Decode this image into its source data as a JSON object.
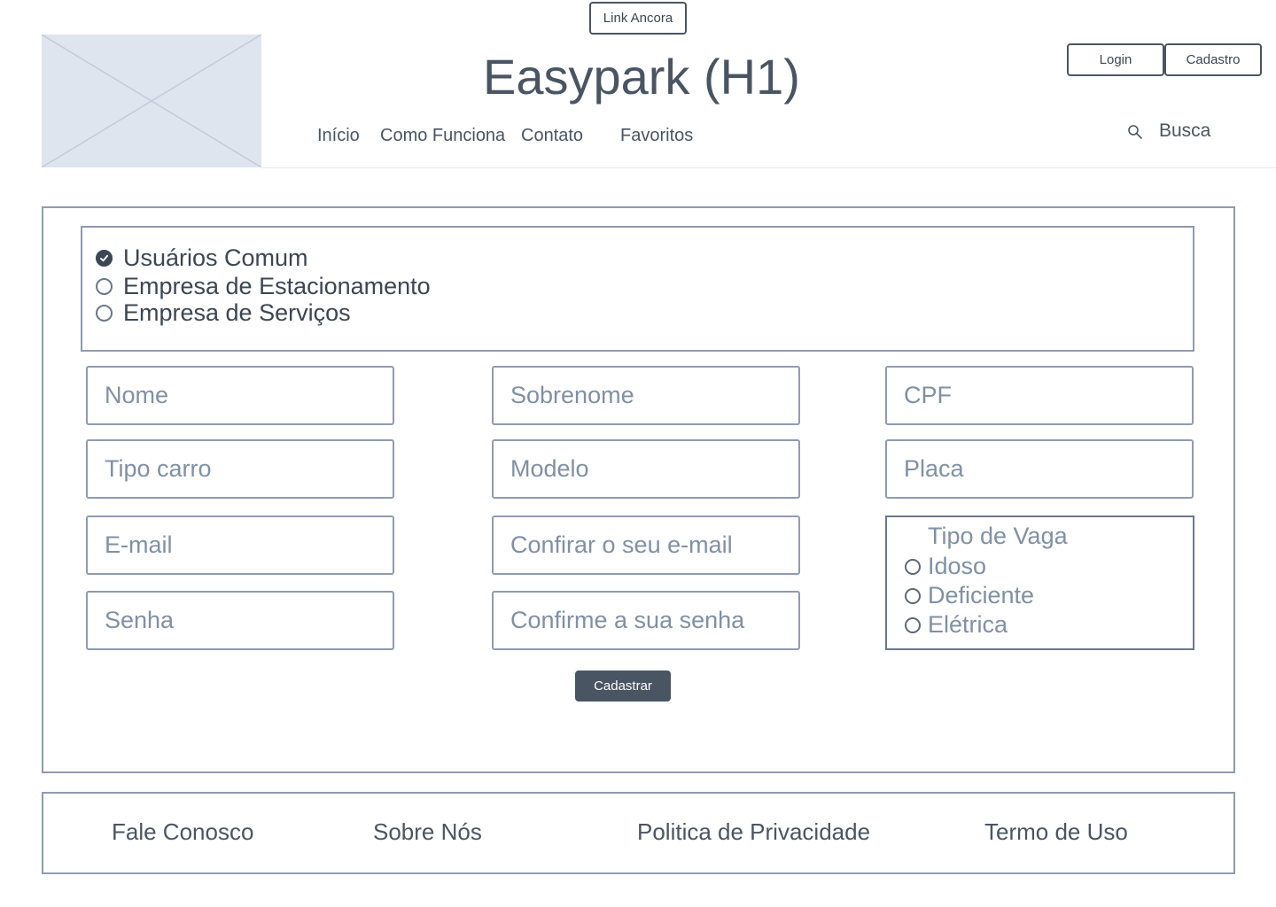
{
  "header": {
    "anchor_link": "Link Ancora",
    "title": "Easypark (H1)",
    "nav": [
      "Início",
      "Como Funciona",
      "Contato",
      "Favoritos"
    ],
    "login_label": "Login",
    "signup_label": "Cadastro",
    "search_label": "Busca"
  },
  "user_type": {
    "options": [
      {
        "label": "Usuários Comum",
        "selected": true
      },
      {
        "label": "Empresa de Estacionamento",
        "selected": false
      },
      {
        "label": "Empresa de Serviços",
        "selected": false
      }
    ]
  },
  "form": {
    "nome": "Nome",
    "sobrenome": "Sobrenome",
    "cpf": "CPF",
    "tipo_carro": "Tipo carro",
    "modelo": "Modelo",
    "placa": "Placa",
    "email": "E-mail",
    "confirm_email": "Confirar o seu e-mail",
    "senha": "Senha",
    "confirm_senha": "Confirme a sua senha",
    "vaga": {
      "title": "Tipo de Vaga",
      "options": [
        "Idoso",
        "Deficiente",
        "Elétrica"
      ]
    },
    "submit_label": "Cadastrar"
  },
  "footer": {
    "links": [
      "Fale Conosco",
      "Sobre Nós",
      "Politica de Privacidade",
      "Termo de Uso"
    ]
  },
  "colors": {
    "text": "#4a5563",
    "border": "#8f9bb0",
    "placeholder": "#8090a5",
    "button_bg": "#4a5563",
    "image_placeholder": "#dfe5ee"
  }
}
